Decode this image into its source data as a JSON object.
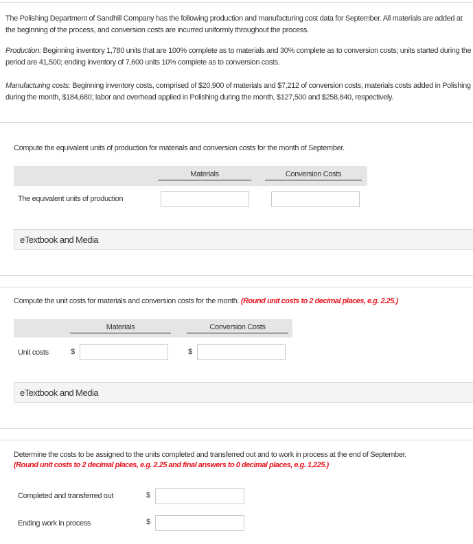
{
  "problem": {
    "intro": "The Polishing Department of Sandhill Company has the following production and manufacturing cost data for September. All materials are added at the beginning of the process, and conversion costs are incurred uniformly throughout the process.",
    "production_label": "Production:",
    "production_text": " Beginning inventory 1,780 units that are 100% complete as to materials and 30% complete as to conversion costs; units started during the period are 41,500; ending inventory of 7,600 units 10% complete as to conversion costs.",
    "manufacturing_label": "Manufacturing costs:",
    "manufacturing_text": " Beginning inventory costs, comprised of $20,900 of materials and $7,212 of conversion costs; materials costs added in Polishing during the month, $184,680; labor and overhead applied in Polishing during the month, $127,500 and $258,840, respectively."
  },
  "part1": {
    "question": "Compute the equivalent units of production for materials and conversion costs for the month of September.",
    "col_materials": "Materials",
    "col_conversion": "Conversion Costs",
    "row_label": "The equivalent units of production",
    "materials_value": "",
    "conversion_value": "",
    "media_label": "eTextbook and Media"
  },
  "part2": {
    "question": "Compute the unit costs for materials and conversion costs for the month. ",
    "instruction": "(Round unit costs to 2 decimal places, e.g. 2.25.)",
    "col_materials": "Materials",
    "col_conversion": "Conversion Costs",
    "row_label": "Unit costs",
    "currency": "$",
    "materials_value": "",
    "conversion_value": "",
    "media_label": "eTextbook and Media"
  },
  "part3": {
    "question": "Determine the costs to be assigned to the units completed and transferred out and to work in process at the end of September.",
    "instruction": "(Round unit costs to 2 decimal places, e.g. 2.25 and final answers to 0 decimal places, e.g. 1,225.)",
    "currency": "$",
    "rows": [
      {
        "label": "Completed and transferred out",
        "value": ""
      },
      {
        "label": "Ending work in process",
        "value": ""
      }
    ]
  },
  "colors": {
    "instruction_red": "#e8141e",
    "band_gray": "#e5e5e5",
    "media_bg": "#f4f4f4"
  }
}
